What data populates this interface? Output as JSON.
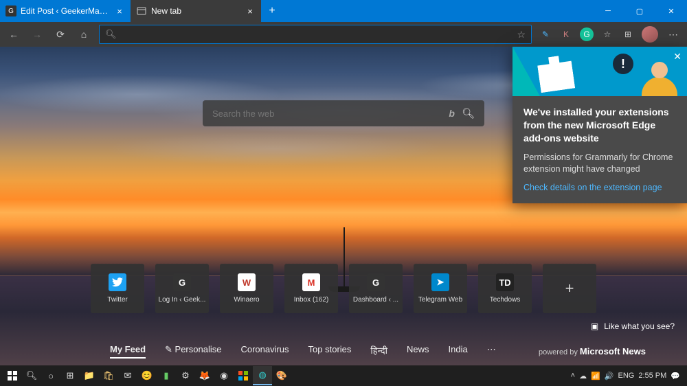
{
  "tabs": [
    {
      "label": "Edit Post ‹ GeekerMag — WordP",
      "favicon_letter": "G",
      "favicon_bg": "#333",
      "active": false
    },
    {
      "label": "New tab",
      "favicon_letter": "",
      "favicon_bg": "transparent",
      "active": true
    }
  ],
  "toolbar": {
    "address_value": "",
    "extensions": [
      {
        "name": "ext-pen",
        "glyph": "✎",
        "color": "#4db8ff"
      },
      {
        "name": "ext-k",
        "glyph": "K",
        "color": "#d08080"
      },
      {
        "name": "ext-grammarly",
        "glyph": "G",
        "color": "#fff",
        "bg": "#15c39a",
        "round": true
      },
      {
        "name": "favorites-icon",
        "glyph": "☆",
        "color": "#ccc"
      },
      {
        "name": "collections-icon",
        "glyph": "⊞",
        "color": "#ccc"
      }
    ]
  },
  "search": {
    "placeholder": "Search the web"
  },
  "tiles": [
    {
      "label": "Twitter",
      "icon_bg": "#1da1f2",
      "icon_text": "",
      "icon_svg": "bird"
    },
    {
      "label": "Log In ‹ Geek...",
      "icon_bg": "#333",
      "icon_text": "G",
      "icon_color": "#fff"
    },
    {
      "label": "Winaero",
      "icon_bg": "#fff",
      "icon_text": "W",
      "icon_color": "#c0392b"
    },
    {
      "label": "Inbox (162)",
      "icon_bg": "#fff",
      "icon_text": "M",
      "icon_color": "#d93025"
    },
    {
      "label": "Dashboard ‹ ...",
      "icon_bg": "#333",
      "icon_text": "G",
      "icon_color": "#fff"
    },
    {
      "label": "Telegram Web",
      "icon_bg": "#0088cc",
      "icon_text": "➤",
      "icon_color": "#fff"
    },
    {
      "label": "Techdows",
      "icon_bg": "#222",
      "icon_text": "TD",
      "icon_color": "#fff"
    }
  ],
  "like_text": "Like what you see?",
  "feed": {
    "items": [
      "My Feed",
      "✎ Personalise",
      "Coronavirus",
      "Top stories",
      "हिन्दी",
      "News",
      "India",
      "⋯"
    ],
    "active_index": 0,
    "powered_prefix": "powered by ",
    "powered_brand": "Microsoft News"
  },
  "notification": {
    "title": "We've installed your extensions from the new Microsoft Edge add-ons website",
    "text": "Permissions for Grammarly for Chrome extension might have changed",
    "link": "Check details on the extension page"
  },
  "tray": {
    "lang": "ENG",
    "time": "2:55 PM"
  }
}
